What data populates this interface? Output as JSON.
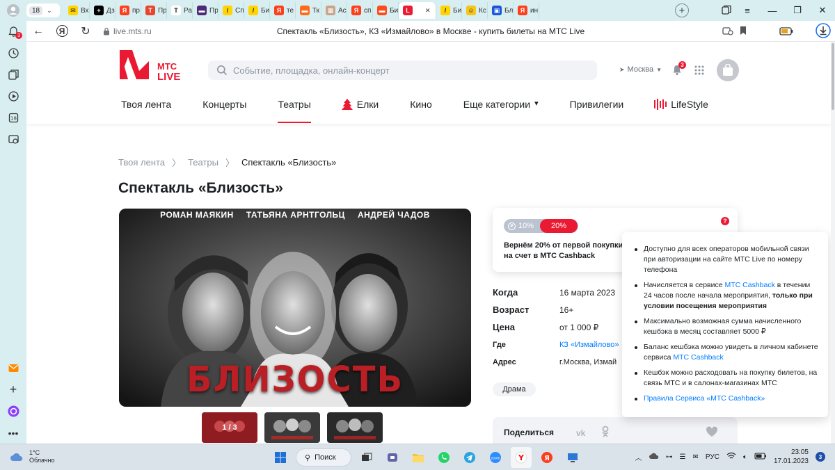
{
  "browser": {
    "tab_count": "18",
    "tabs": [
      {
        "label": "Вх",
        "color": "#ffd400",
        "glyph": "✉"
      },
      {
        "label": "Дз",
        "color": "#000000",
        "glyph": "+"
      },
      {
        "label": "пр",
        "color": "#fc3f1d",
        "glyph": "Я"
      },
      {
        "label": "Пр",
        "color": "#e8452f",
        "glyph": "Т"
      },
      {
        "label": "Ра",
        "color": "#ffffff",
        "glyph": "T"
      },
      {
        "label": "Пр",
        "color": "#4c2a75",
        "glyph": "▬"
      },
      {
        "label": "Сп",
        "color": "#ffd400",
        "glyph": "/"
      },
      {
        "label": "Би",
        "color": "#ffd400",
        "glyph": "/"
      },
      {
        "label": "те",
        "color": "#fc3f1d",
        "glyph": "Я"
      },
      {
        "label": "Тк",
        "color": "#ff6b1a",
        "glyph": "▬"
      },
      {
        "label": "Ас",
        "color": "#c8a48a",
        "glyph": "▦"
      },
      {
        "label": "сп",
        "color": "#fc3f1d",
        "glyph": "Я"
      },
      {
        "label": "Би",
        "color": "#ff4a1a",
        "glyph": "▬"
      },
      {
        "label": "",
        "color": "#ea1a32",
        "glyph": "L",
        "active": true
      },
      {
        "label": "Би",
        "color": "#ffd400",
        "glyph": "/"
      },
      {
        "label": "Кс",
        "color": "#f5c518",
        "glyph": "☺"
      },
      {
        "label": "Бл",
        "color": "#1a56db",
        "glyph": "▣"
      },
      {
        "label": "ин",
        "color": "#fc3f1d",
        "glyph": "Я"
      }
    ],
    "domain": "live.mts.ru",
    "page_title": "Спектакль «Близость», КЗ «Измайлово» в Москве - купить билеты на МТС Live"
  },
  "site": {
    "logo_text": "МТС LIVE",
    "search_placeholder": "Событие, площадка, онлайн-концерт",
    "city": "Москва",
    "notifications": "3",
    "nav": [
      {
        "label": "Твоя лента"
      },
      {
        "label": "Концерты"
      },
      {
        "label": "Театры",
        "active": true
      },
      {
        "label": "Елки",
        "icon": "tree-icon"
      },
      {
        "label": "Кино"
      },
      {
        "label": "Еще категории",
        "dropdown": true
      },
      {
        "label": "Привилегии"
      },
      {
        "label": "LifeStyle",
        "icon": "lifestyle-icon"
      }
    ]
  },
  "breadcrumbs": [
    "Твоя лента",
    "Театры",
    "Спектакль «Близость»"
  ],
  "event": {
    "title": "Спектакль «Близость»",
    "poster_cast": [
      "РОМАН МАЯКИН",
      "ТАТЬЯНА АРНТГОЛЬЦ",
      "АНДРЕЙ ЧАДОВ"
    ],
    "poster_title": "БЛИЗОСТЬ",
    "gallery_counter": "1 / 3",
    "details": [
      {
        "label": "Когда",
        "value": "16 марта 2023"
      },
      {
        "label": "Возраст",
        "value": "16+"
      },
      {
        "label": "Цена",
        "value": "от 1 000 ₽"
      },
      {
        "label": "Где",
        "value": "КЗ «Измайлово»"
      },
      {
        "label": "Адрес",
        "value": "г.Москва, Измай"
      }
    ],
    "genre": "Драма"
  },
  "cashback": {
    "option_low": "10%",
    "option_high": "20%",
    "help": "?",
    "text_prefix": "Вернём",
    "text_percent": "20%",
    "text_rest": "от первой покупки",
    "text_line2": "на счет в МТС Cashback"
  },
  "tooltip": {
    "items": [
      {
        "text": "Доступно для всех операторов мобильной связи при авторизации на сайте МТС Live по номеру телефона"
      },
      {
        "pre": "Начисляется в сервисе ",
        "link": "МТС Cashback",
        "mid": " в течении 24 часов после начала мероприятия, ",
        "bold": "только при условии посещения мероприятия"
      },
      {
        "text": "Максимально возможная сумма начисленного кешбэка в месяц составляет 5000 ₽"
      },
      {
        "pre": "Баланс кешбэка можно увидеть в личном кабинете сервиса ",
        "link": "МТС Cashback"
      },
      {
        "text": "Кешбэк можно расходовать на покупку билетов, на связь МТС и в салонах-магазинах МТС"
      },
      {
        "link": "Правила Сервиса «МТС Cashback»"
      }
    ]
  },
  "share": {
    "label": "Поделиться",
    "vk": "vk"
  },
  "taskbar": {
    "weather_temp": "1°C",
    "weather_desc": "Облачно",
    "search_label": "Поиск",
    "lang": "РУС",
    "time": "23:05",
    "date": "17.01.2023",
    "notif_count": "3"
  },
  "colors": {
    "brand_red": "#ea1a32",
    "link_blue": "#007cff"
  }
}
